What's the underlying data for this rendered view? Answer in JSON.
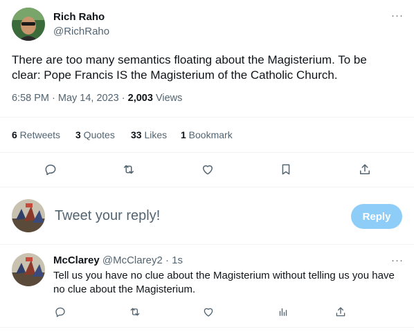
{
  "tweet": {
    "author_name": "Rich Raho",
    "author_handle": "@RichRaho",
    "more_label": "···",
    "text": "There are too many semantics floating about the Magisterium. To be clear: Pope Francis IS the Magisterium of the Catholic Church.",
    "timestamp": "6:58 PM · May 14, 2023 · ",
    "views_count": "2,003",
    "views_label": " Views",
    "stats": {
      "retweets_count": "6",
      "retweets_label": " Retweets",
      "quotes_count": "3",
      "quotes_label": " Quotes",
      "likes_count": "33",
      "likes_label": " Likes",
      "bookmarks_count": "1",
      "bookmarks_label": " Bookmark"
    }
  },
  "composer": {
    "placeholder": "Tweet your reply!",
    "reply_button": "Reply"
  },
  "reply": {
    "author_name": "McClarey",
    "author_handle": "@McClarey2",
    "time": " · 1s",
    "more_label": "···",
    "text": "Tell us you have no clue about the Magisterium without telling us you have no clue about the Magisterium."
  },
  "icons": [
    "reply-icon",
    "retweet-icon",
    "like-icon",
    "bookmark-icon",
    "share-icon",
    "views-icon"
  ],
  "colors": {
    "accent": "#1d9bf0",
    "reply_button_disabled": "#8ecdf8",
    "text": "#0f1419",
    "muted": "#536471",
    "divider": "#eff3f4"
  }
}
